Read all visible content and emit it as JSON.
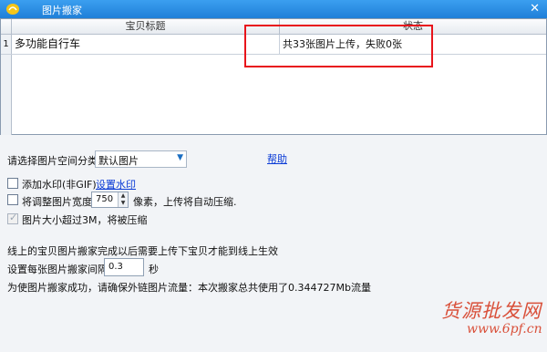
{
  "window": {
    "title": "图片搬家",
    "close_glyph": "✕"
  },
  "grid": {
    "columns": [
      "宝贝标题",
      "状态"
    ],
    "rows": [
      {
        "num": "1",
        "title": "多功能自行车",
        "status": "共33张图片上传，失败0张"
      }
    ]
  },
  "settings": {
    "category_label": "请选择图片空间分类",
    "category_value": "默认图片",
    "help_link": "帮助",
    "watermark_label": "添加水印(非GIF)",
    "watermark_link": "设置水印",
    "resize_label": "将调整图片宽度",
    "resize_value": "750",
    "resize_suffix": "像素，上传将自动压缩.",
    "compress_label": "图片大小超过3M，将被压缩",
    "online_note": "线上的宝贝图片搬家完成以后需要上传下宝贝才能到线上生效",
    "interval_label": "设置每张图片搬家间隔",
    "interval_value": "0.3",
    "interval_unit": "秒",
    "traffic_note": "为使图片搬家成功，请确保外链图片流量：本次搬家总共使用了0.344727Mb流量"
  },
  "watermark_brand": {
    "cn": "货源批发网",
    "url": "www.6pf.cn"
  },
  "colors": {
    "titlebar": "#2b8fe6",
    "highlight": "#e8141b",
    "link": "#0b3bd6",
    "watermark": "#d9503a"
  }
}
